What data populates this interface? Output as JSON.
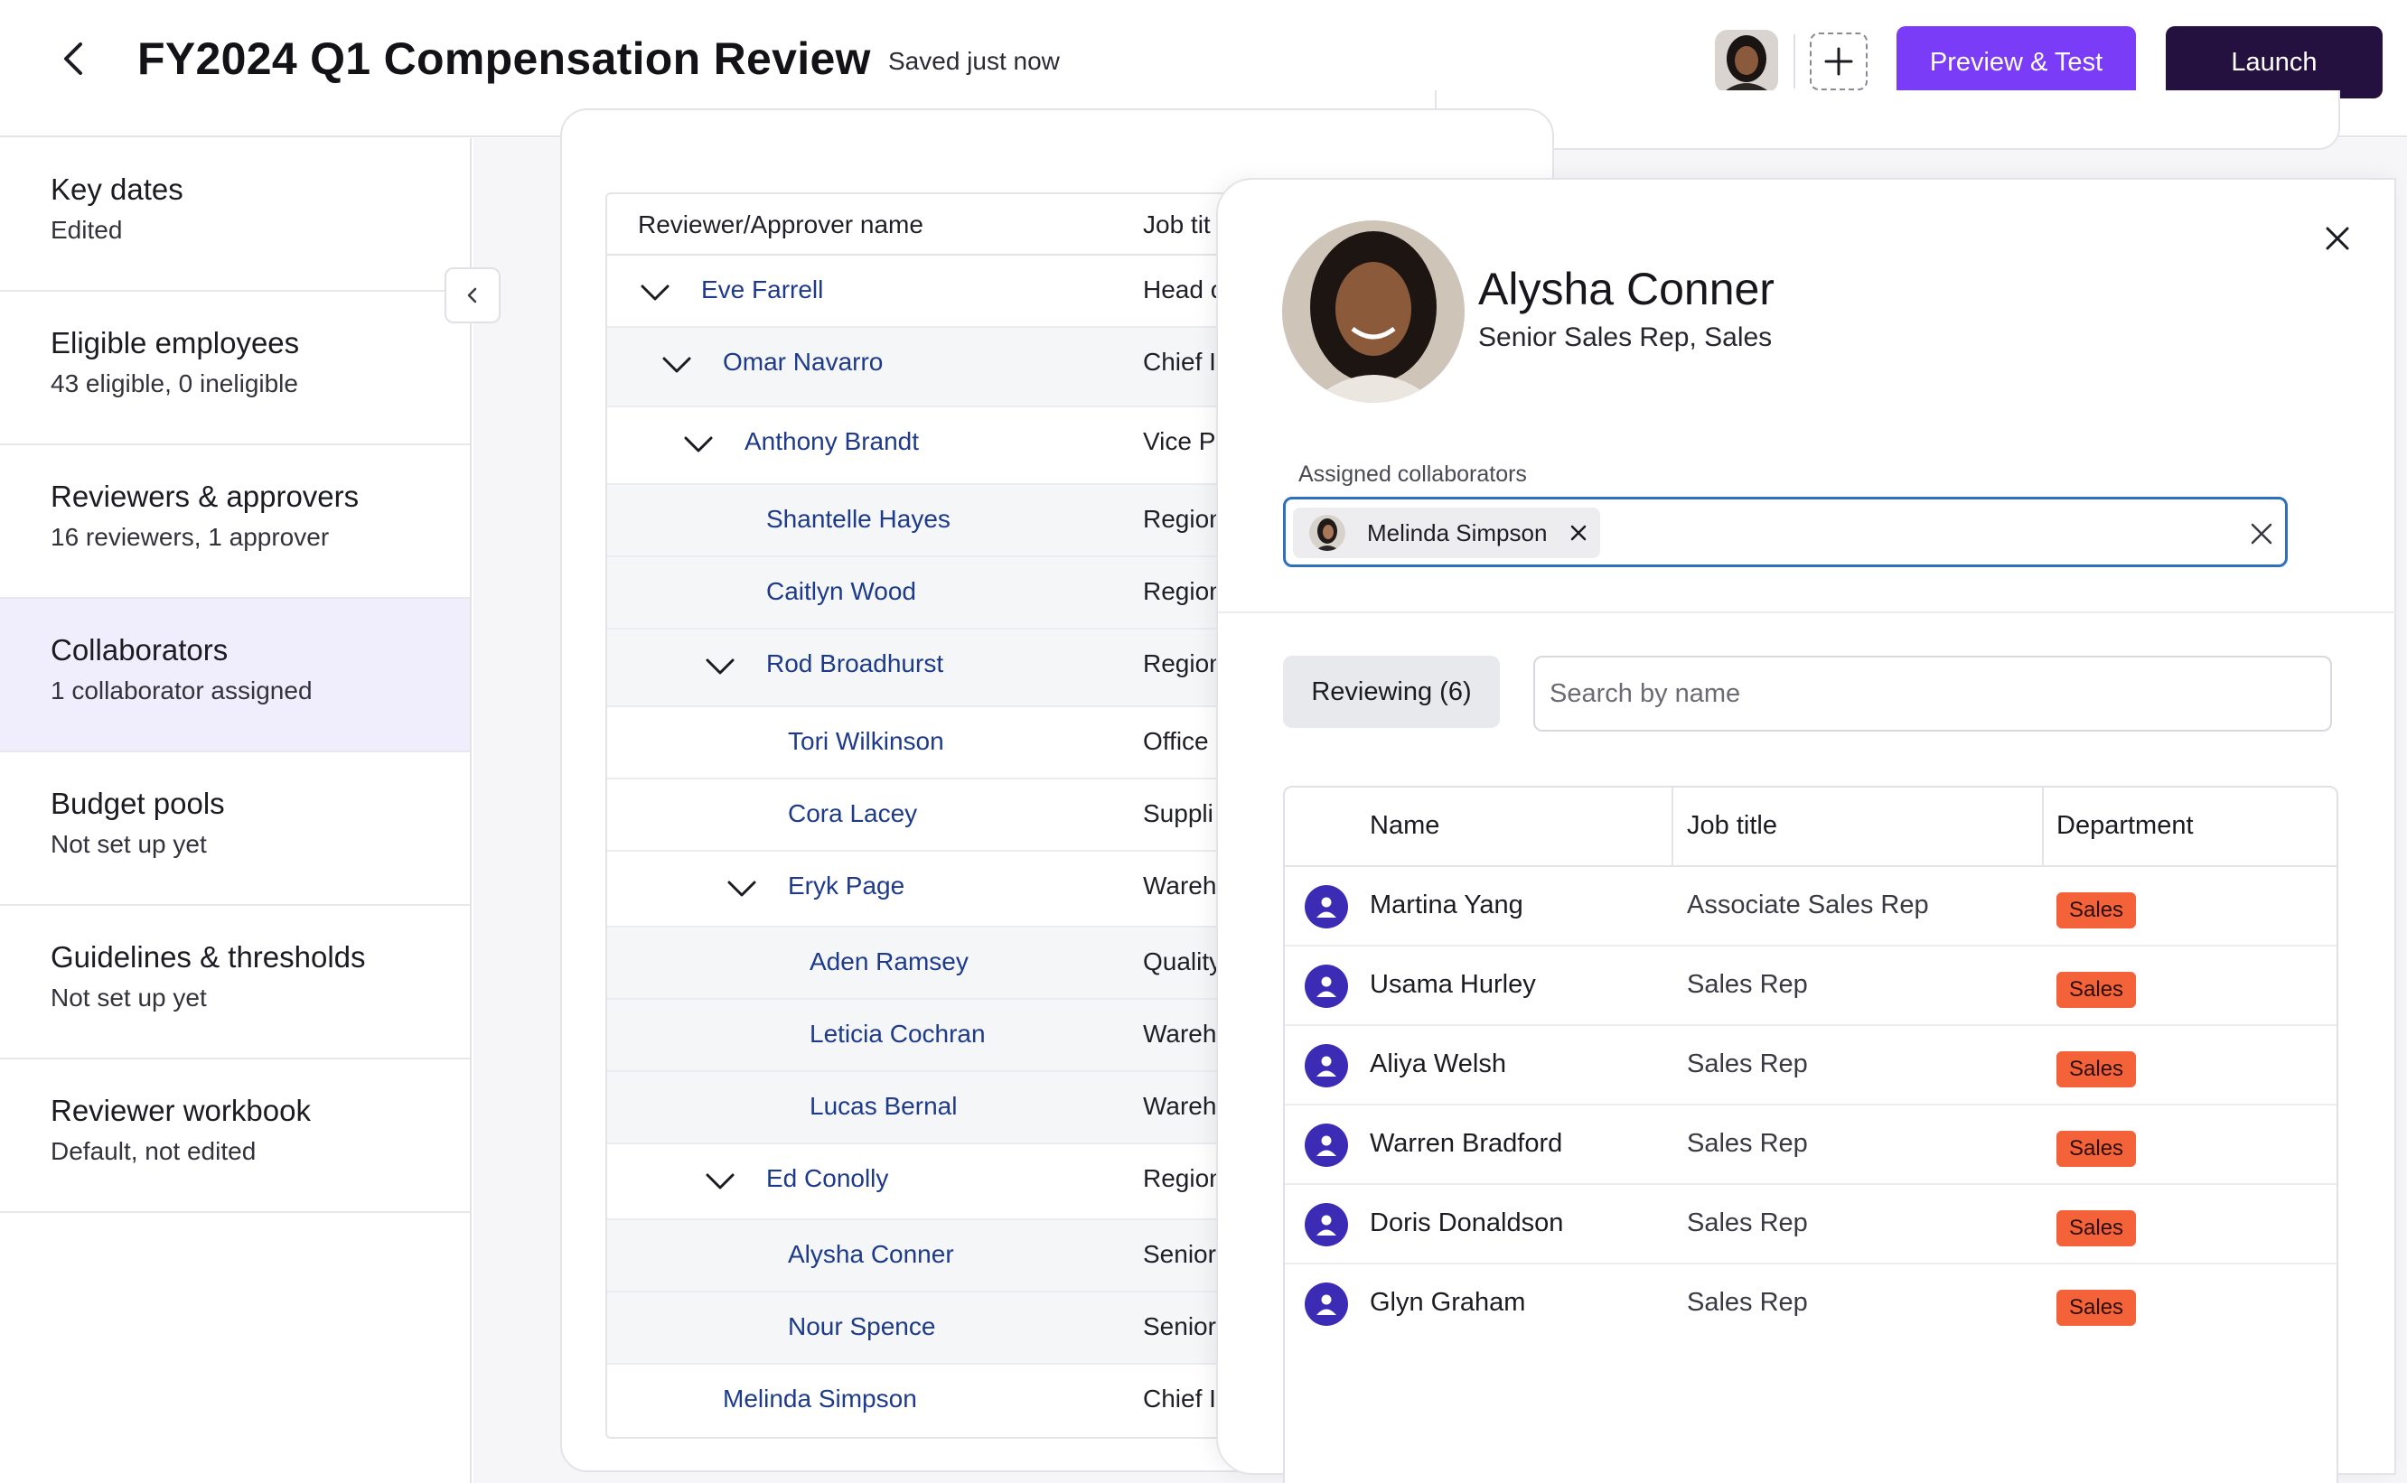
{
  "header": {
    "title": "FY2024 Q1 Compensation Review",
    "save_status": "Saved just now",
    "preview_label": "Preview & Test",
    "launch_label": "Launch"
  },
  "sidebar": {
    "items": [
      {
        "title": "Key dates",
        "subtitle": "Edited"
      },
      {
        "title": "Eligible employees",
        "subtitle": "43 eligible, 0 ineligible"
      },
      {
        "title": "Reviewers & approvers",
        "subtitle": "16 reviewers, 1 approver"
      },
      {
        "title": "Collaborators",
        "subtitle": "1 collaborator assigned"
      },
      {
        "title": "Budget pools",
        "subtitle": "Not set up yet"
      },
      {
        "title": "Guidelines & thresholds",
        "subtitle": "Not set up yet"
      },
      {
        "title": "Reviewer workbook",
        "subtitle": "Default, not edited"
      }
    ]
  },
  "tree": {
    "col_name": "Reviewer/Approver name",
    "col_title": "Job tit",
    "rows": [
      {
        "name": "Eve Farrell",
        "title": "Head c"
      },
      {
        "name": "Omar Navarro",
        "title": "Chief I"
      },
      {
        "name": "Anthony Brandt",
        "title": "Vice Pr"
      },
      {
        "name": "Shantelle Hayes",
        "title": "Region"
      },
      {
        "name": "Caitlyn Wood",
        "title": "Region"
      },
      {
        "name": "Rod Broadhurst",
        "title": "Region"
      },
      {
        "name": "Tori Wilkinson",
        "title": "Office"
      },
      {
        "name": "Cora Lacey",
        "title": "Suppli"
      },
      {
        "name": "Eryk Page",
        "title": "Wareh"
      },
      {
        "name": "Aden Ramsey",
        "title": "Quality"
      },
      {
        "name": "Leticia Cochran",
        "title": "Wareh"
      },
      {
        "name": "Lucas Bernal",
        "title": "Wareh"
      },
      {
        "name": "Ed Conolly",
        "title": "Region"
      },
      {
        "name": "Alysha Conner",
        "title": "Senior"
      },
      {
        "name": "Nour Spence",
        "title": "Senior"
      },
      {
        "name": "Melinda Simpson",
        "title": "Chief I"
      }
    ]
  },
  "panel": {
    "name": "Alysha Conner",
    "role": "Senior Sales Rep, Sales",
    "assigned_label": "Assigned collaborators",
    "chip_label": "Melinda Simpson",
    "reviewing_tab": "Reviewing (6)",
    "search_placeholder": "Search by name",
    "table": {
      "col_name": "Name",
      "col_title": "Job title",
      "col_dept": "Department",
      "rows": [
        {
          "name": "Martina Yang",
          "title": "Associate Sales Rep",
          "dept": "Sales"
        },
        {
          "name": "Usama Hurley",
          "title": "Sales Rep",
          "dept": "Sales"
        },
        {
          "name": "Aliya Welsh",
          "title": "Sales Rep",
          "dept": "Sales"
        },
        {
          "name": "Warren Bradford",
          "title": "Sales Rep",
          "dept": "Sales"
        },
        {
          "name": "Doris Donaldson",
          "title": "Sales Rep",
          "dept": "Sales"
        },
        {
          "name": "Glyn Graham",
          "title": "Sales Rep",
          "dept": "Sales"
        }
      ]
    }
  },
  "colors": {
    "primary": "#7a3cf6",
    "launch": "#24113f",
    "link": "#1e3a8a",
    "active_nav": "#f0eefc",
    "badge": "#f4623a",
    "person_icon": "#3b2bb5"
  }
}
